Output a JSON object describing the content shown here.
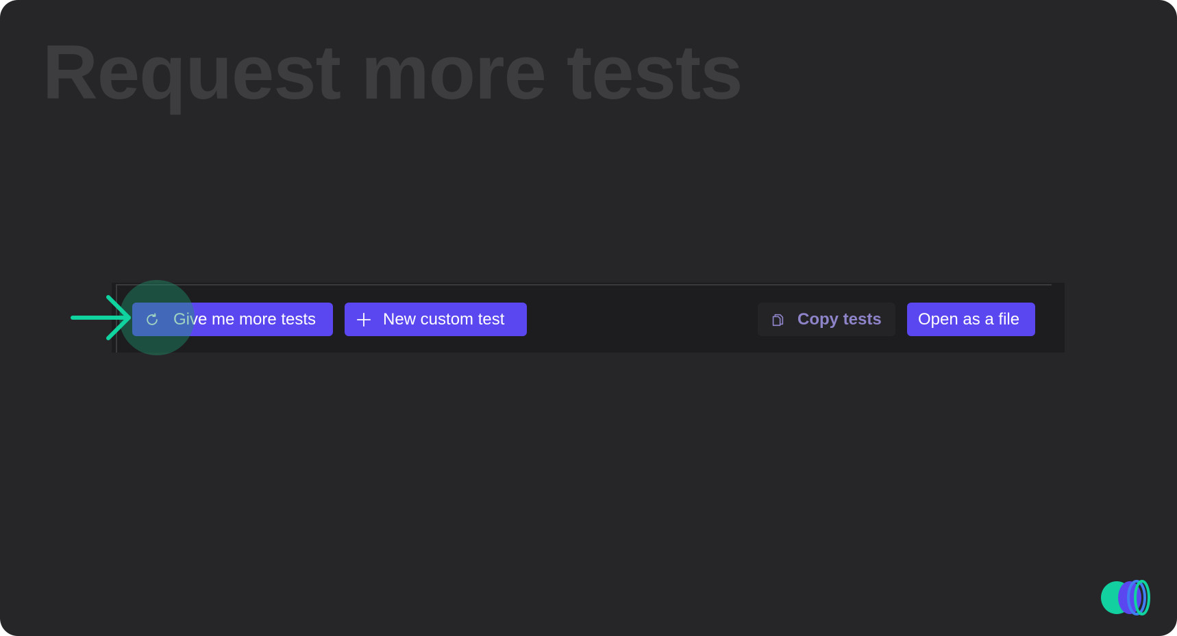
{
  "page": {
    "title": "Request more tests"
  },
  "toolbar": {
    "more_tests_label": "Give me more tests",
    "new_test_label": "New custom test",
    "copy_tests_label": "Copy tests",
    "open_file_label": "Open as a file"
  },
  "icons": {
    "more_tests": "refresh-icon",
    "new_test": "plus-icon",
    "copy_tests": "copy-icon",
    "pointer": "arrow-right-icon",
    "brand": "brand-logo"
  },
  "colors": {
    "background": "#262628",
    "title": "#3d3d40",
    "toolbar": "#1d1d1f",
    "primary_button": "#5b47f0",
    "copy_button_text": "#8d84c9",
    "highlight": "#1e966e",
    "arrow": "#10d3a0"
  }
}
